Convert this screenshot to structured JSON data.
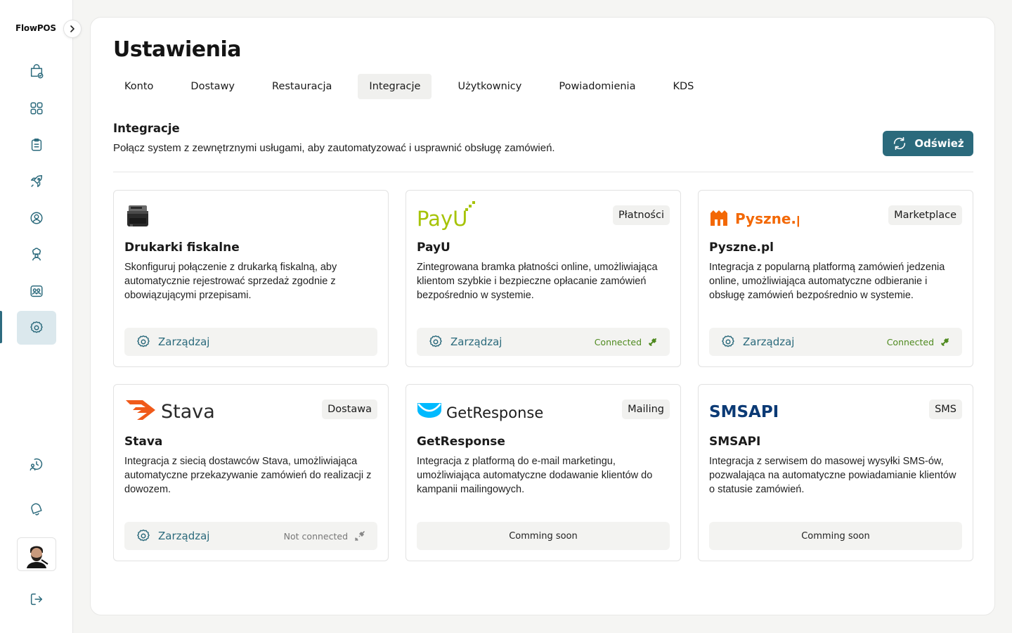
{
  "app": {
    "brand": "FlowPOS"
  },
  "sidebar": {
    "items": [
      {
        "icon": "check-bag-icon"
      },
      {
        "icon": "grid-icon"
      },
      {
        "icon": "clipboard-icon"
      },
      {
        "icon": "rocket-icon"
      },
      {
        "icon": "user-circle-icon"
      },
      {
        "icon": "chef-icon"
      },
      {
        "icon": "team-icon"
      },
      {
        "icon": "gear-icon",
        "active": true
      }
    ],
    "bottom": [
      {
        "icon": "support-icon"
      },
      {
        "icon": "bell-icon"
      },
      {
        "icon": "avatar"
      },
      {
        "icon": "logout-icon"
      }
    ]
  },
  "page": {
    "title": "Ustawienia",
    "tabs": [
      "Konto",
      "Dostawy",
      "Restauracja",
      "Integracje",
      "Użytkownicy",
      "Powiadomienia",
      "KDS"
    ],
    "active_tab": "Integracje"
  },
  "section": {
    "title": "Integracje",
    "description": "Połącz system z zewnętrznymi usługami, aby zautomatyzować i usprawnić obsługę zamówień.",
    "refresh_label": "Odśwież"
  },
  "colors": {
    "accent": "#2b6a7c",
    "connected": "#4f8a1f",
    "active_nav_bg": "#dbe8ed"
  },
  "cards": [
    {
      "logo": "fiscal-printer-icon",
      "badge": "",
      "name": "Drukarki fiskalne",
      "description": "Skonfiguruj połączenie z drukarką fiskalną, aby automatycznie rejestrować sprzedaż zgodnie z obowiązującymi przepisami.",
      "action": "Zarządzaj",
      "status": ""
    },
    {
      "logo": "PayU",
      "badge": "Płatności",
      "name": "PayU",
      "description": "Zintegrowana bramka płatności online, umożliwiająca klientom szybkie i bezpieczne opłacanie zamówień bezpośrednio w systemie.",
      "action": "Zarządzaj",
      "status": "Connected"
    },
    {
      "logo": "Pyszne.pl",
      "badge": "Marketplace",
      "name": "Pyszne.pl",
      "description": "Integracja z popularną platformą zamówień jedzenia online, umożliwiająca automatyczne odbieranie i obsługę zamówień bezpośrednio w systemie.",
      "action": "Zarządzaj",
      "status": "Connected"
    },
    {
      "logo": "Stava",
      "badge": "Dostawa",
      "name": "Stava",
      "description": "Integracja z siecią dostawców Stava, umożliwiająca automatyczne przekazywanie zamówień do realizacji z dowozem.",
      "action": "Zarządzaj",
      "status": "Not connected"
    },
    {
      "logo": "GetResponse",
      "badge": "Mailing",
      "name": "GetResponse",
      "description": "Integracja z platformą do e-mail marketingu, umożliwiająca automatyczne dodawanie klientów do kampanii mailingowych.",
      "action": "Comming soon",
      "status": ""
    },
    {
      "logo": "SMSAPI",
      "badge": "SMS",
      "name": "SMSAPI",
      "description": "Integracja z serwisem do masowej wysyłki SMS-ów, pozwalająca na automatyczne powiadamianie klientów o statusie zamówień.",
      "action": "Comming soon",
      "status": ""
    }
  ]
}
